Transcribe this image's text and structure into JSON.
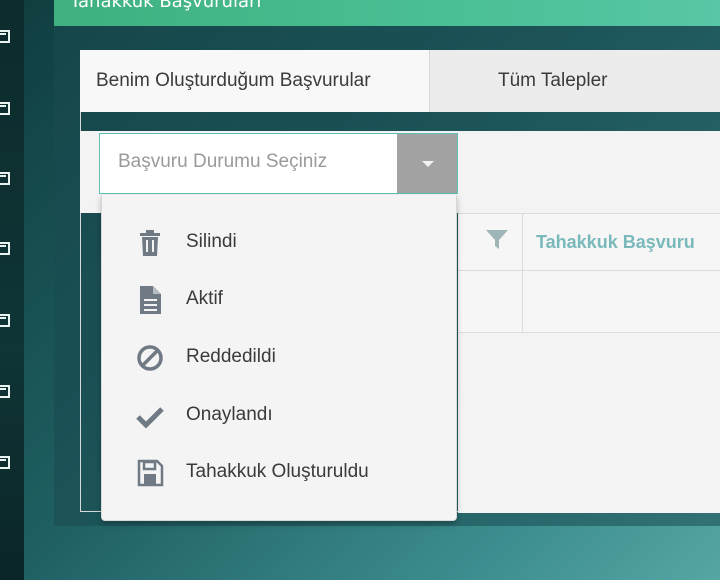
{
  "header": {
    "title": "Tahakkuk Başvuruları"
  },
  "tabs": [
    {
      "label": "Benim Oluşturduğum Başvurular",
      "active": true
    },
    {
      "label": "Tüm Talepler",
      "active": false
    }
  ],
  "status_select": {
    "placeholder": "Başvuru Durumu Seçiniz",
    "options": [
      {
        "label": "Silindi",
        "icon": "trash-icon"
      },
      {
        "label": "Aktif",
        "icon": "document-icon"
      },
      {
        "label": "Reddedildi",
        "icon": "ban-icon"
      },
      {
        "label": "Onaylandı",
        "icon": "check-icon"
      },
      {
        "label": "Tahakkuk Oluşturuldu",
        "icon": "save-icon"
      }
    ]
  },
  "grid": {
    "column_title": "Tahakkuk Başvuru"
  },
  "colors": {
    "accent": "#5dbfb6",
    "header": "#4bbf95",
    "column_title": "#7ab9bb",
    "icon": "#6f7a84"
  }
}
